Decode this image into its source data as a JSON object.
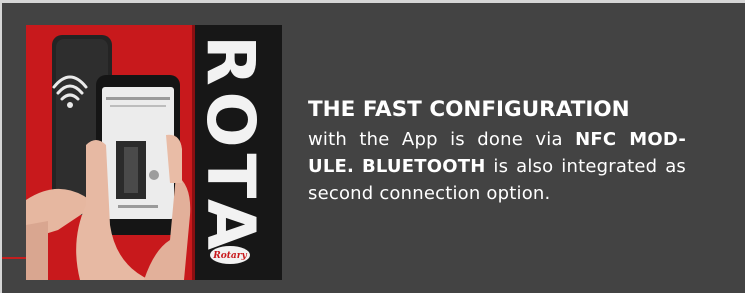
{
  "card": {
    "headline": "THE FAST CONFIGURATION",
    "body": {
      "t1": "with the App is done via ",
      "b1": "NFC MOD-",
      "b2": "ULE.",
      "b3": "BLUETOOTH",
      "t2": " is also integrated",
      "t3": "as second connection option."
    }
  },
  "photo": {
    "sign_text": "ROTA",
    "logo_text": "Rotary",
    "icons": [
      "nfc-icon"
    ]
  },
  "colors": {
    "card_bg": "#434343",
    "page_bg": "#d6d6d6",
    "accent_red": "#c41e1e",
    "text": "#ffffff"
  }
}
